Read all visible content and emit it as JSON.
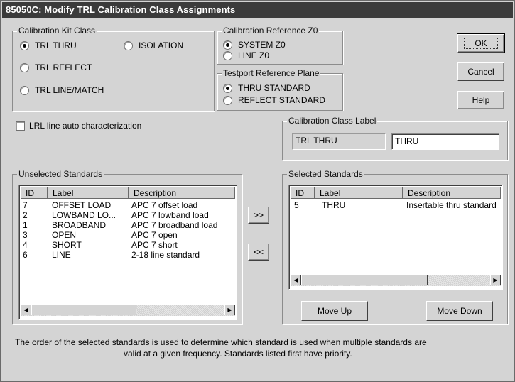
{
  "window": {
    "title": "85050C: Modify TRL Calibration Class Assignments"
  },
  "kit_class": {
    "title": "Calibration Kit Class",
    "options": [
      {
        "label": "TRL THRU",
        "selected": true
      },
      {
        "label": "ISOLATION",
        "selected": false
      },
      {
        "label": "TRL REFLECT",
        "selected": false
      },
      {
        "label": "TRL LINE/MATCH",
        "selected": false
      }
    ]
  },
  "ref_z0": {
    "title": "Calibration Reference Z0",
    "options": [
      {
        "label": "SYSTEM Z0",
        "selected": true
      },
      {
        "label": "LINE Z0",
        "selected": false
      }
    ]
  },
  "ref_plane": {
    "title": "Testport Reference Plane",
    "options": [
      {
        "label": "THRU STANDARD",
        "selected": true
      },
      {
        "label": "REFLECT STANDARD",
        "selected": false
      }
    ]
  },
  "buttons": {
    "ok": "OK",
    "cancel": "Cancel",
    "help": "Help",
    "add": ">>",
    "remove": "<<",
    "move_up": "Move Up",
    "move_down": "Move Down"
  },
  "lrl": {
    "label": "LRL line auto characterization",
    "checked": false
  },
  "class_label": {
    "title": "Calibration Class Label",
    "class_name": "TRL THRU",
    "value": "THRU"
  },
  "unselected": {
    "title": "Unselected Standards",
    "columns": [
      "ID",
      "Label",
      "Description"
    ],
    "rows": [
      {
        "id": "7",
        "label": "OFFSET LOAD",
        "desc": "APC 7 offset load"
      },
      {
        "id": "2",
        "label": "LOWBAND LO...",
        "desc": "APC 7 lowband load"
      },
      {
        "id": "1",
        "label": "BROADBAND",
        "desc": "APC 7 broadband load"
      },
      {
        "id": "3",
        "label": "OPEN",
        "desc": "APC 7  open"
      },
      {
        "id": "4",
        "label": "SHORT",
        "desc": "APC 7  short"
      },
      {
        "id": "6",
        "label": "LINE",
        "desc": "2-18 line standard"
      }
    ]
  },
  "selected": {
    "title": "Selected Standards",
    "columns": [
      "ID",
      "Label",
      "Description"
    ],
    "rows": [
      {
        "id": "5",
        "label": "THRU",
        "desc": "Insertable thru standard"
      }
    ]
  },
  "footer": {
    "line1": "The order of the selected standards is used to determine which standard is used when multiple standards are",
    "line2": "valid at a given frequency. Standards listed first have priority."
  }
}
